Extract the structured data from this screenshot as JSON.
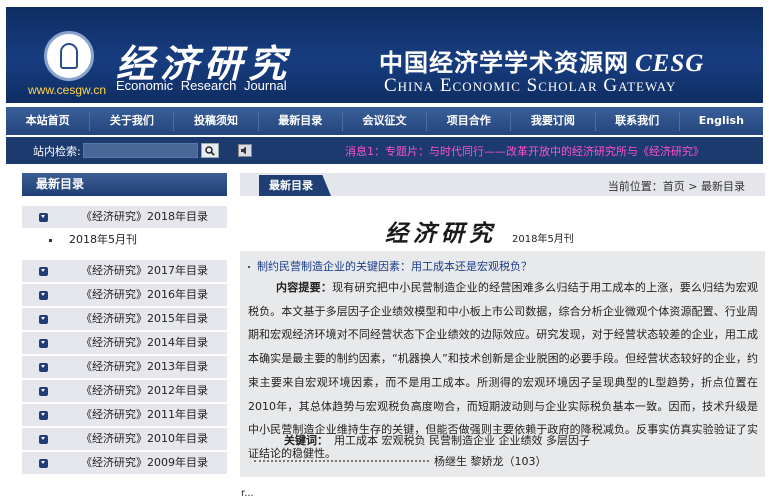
{
  "banner": {
    "magazine_title": "经济研究",
    "url": "www.cesgw.cn",
    "journal_en": "Economic Research Journal",
    "site_cn": "中国经济学学术资源网",
    "site_abbr": "CESG",
    "site_en": "China Economic Scholar Gateway"
  },
  "nav": {
    "items": [
      "本站首页",
      "关于我们",
      "投稿须知",
      "最新目录",
      "会议征文",
      "项目合作",
      "我要订阅",
      "联系我们",
      "English"
    ]
  },
  "search": {
    "label": "站内检索:",
    "placeholder": "",
    "ticker": "消息1：专题片：与时代同行——改革开放中的经济研究所与《经济研究》"
  },
  "sidebar": {
    "title": "最新目录",
    "current_year": "《经济研究》2018年目录",
    "current_issue": "2018年5月刊",
    "years": [
      "《经济研究》2017年目录",
      "《经济研究》2016年目录",
      "《经济研究》2015年目录",
      "《经济研究》2014年目录",
      "《经济研究》2013年目录",
      "《经济研究》2012年目录",
      "《经济研究》2011年目录",
      "《经济研究》2010年目录",
      "《经济研究》2009年目录"
    ]
  },
  "main": {
    "tab": "最新目录",
    "breadcrumb": "当前位置：首页 > 最新目录",
    "issue_title": "经济研究",
    "issue_date": "2018年5月刊",
    "article": {
      "title": "制约民营制造企业的关键因素：用工成本还是宏观税负？",
      "abstract_label": "内容提要：",
      "abstract": "现有研究把中小民营制造企业的经营困难多么归结于用工成本的上涨，要么归结为宏观税负。本文基于多层因子企业绩效模型和中小板上市公司数据，综合分析企业微观个体资源配置、行业周期和宏观经济环境对不同经营状态下企业绩效的边际效应。研究发现，对于经营状态较差的企业，用工成本确实是最主要的制约因素，“机器换人”和技术创新是企业脱困的必要手段。但经营状态较好的企业，约束主要来自宏观环境因素，而不是用工成本。所测得的宏观环境因子呈现典型的L型趋势，折点位置在2010年，其总体趋势与宏观税负高度吻合，而短期波动则与企业实际税负基本一致。因而，技术升级是中小民营制造企业维持生存的关键，但能否做强则主要依赖于政府的降税减负。反事实仿真实验验证了实证结论的稳健性。",
      "keywords_label": "关键词：",
      "keywords": "用工成本  宏观税负  民营制造企业  企业绩效  多层因子",
      "authors": "杨继生  黎娇龙（103）"
    }
  },
  "footer_mark": "r..."
}
